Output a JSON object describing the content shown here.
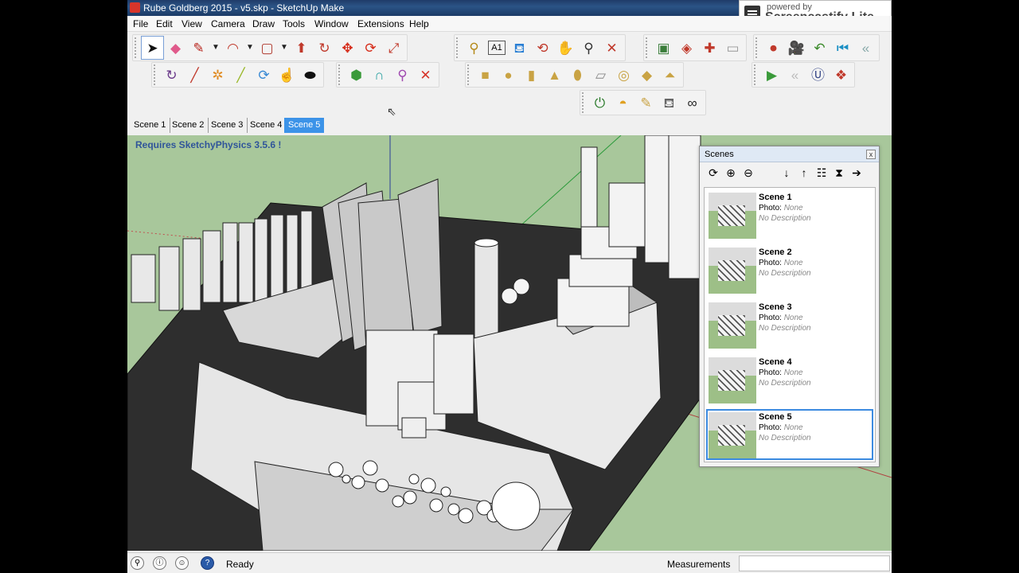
{
  "window": {
    "title": "Rube Goldberg 2015 - v5.skp - SketchUp Make"
  },
  "recorder": {
    "small": "powered by",
    "big": "Screencastify Lite"
  },
  "menu": [
    "File",
    "Edit",
    "View",
    "Camera",
    "Draw",
    "Tools",
    "Window",
    "Extensions",
    "Help"
  ],
  "tabs": [
    "Scene 1",
    "Scene 2",
    "Scene 3",
    "Scene 4",
    "Scene 5"
  ],
  "active_tab": "Scene 5",
  "viewport": {
    "note": "Requires SketchyPhysics 3.5.6 !",
    "background": "#a8c79b"
  },
  "scenes_panel": {
    "title": "Scenes",
    "close": "x",
    "photo_label": "Photo:",
    "photo_value": "None",
    "items": [
      {
        "name": "Scene 1",
        "description": "No Description"
      },
      {
        "name": "Scene 2",
        "description": "No Description"
      },
      {
        "name": "Scene 3",
        "description": "No Description"
      },
      {
        "name": "Scene 4",
        "description": "No Description"
      },
      {
        "name": "Scene 5",
        "description": "No Description"
      }
    ],
    "selected": "Scene 5"
  },
  "status": {
    "text": "Ready",
    "measurements_label": "Measurements",
    "measurements_value": ""
  },
  "toolbar_icons": {
    "row1_a": [
      "select-tool",
      "eraser-tool",
      "line-tool",
      "arc-tool",
      "rectangle-tool",
      "push-pull-tool",
      "follow-me-tool",
      "move-tool",
      "rotate-tool",
      "scale-tool"
    ],
    "row1_b": [
      "tape-measure-tool",
      "text-tool",
      "paint-bucket-tool",
      "orbit-tool",
      "pan-tool",
      "zoom-tool",
      "zoom-extents-tool"
    ],
    "row1_c": [
      "warehouse-tool",
      "share-model-tool",
      "extension-warehouse-tool",
      "layout-tool"
    ],
    "row1_d": [
      "record-button",
      "camera-tool",
      "undo-tool",
      "previous-tool",
      "rewind-tool"
    ]
  }
}
